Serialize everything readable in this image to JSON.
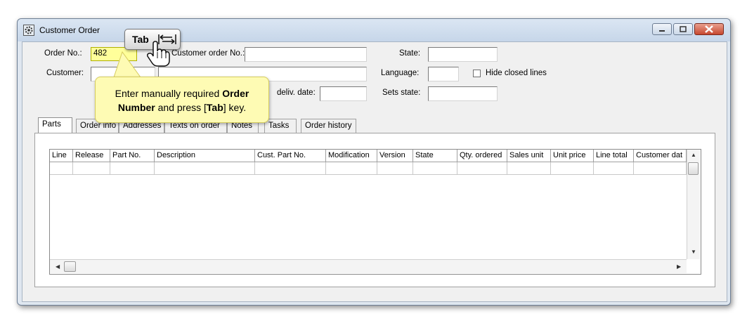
{
  "window": {
    "title": "Customer Order",
    "controls": [
      "minimize",
      "maximize",
      "close"
    ]
  },
  "form": {
    "order_no_label": "Order No.:",
    "order_no_value": "482",
    "customer_order_no_label": "Customer order No.:",
    "customer_order_no_value": "",
    "state_label": "State:",
    "state_value": "",
    "customer_label": "Customer:",
    "customer_value": "",
    "customer_name_value": "",
    "language_label": "Language:",
    "language_value": "",
    "hide_closed_lines_label": "Hide closed lines",
    "hide_closed_lines_checked": false,
    "deliv_date_label": "deliv. date:",
    "deliv_date_value": "",
    "sets_state_label": "Sets state:",
    "sets_state_value": ""
  },
  "tabs": [
    {
      "label": "Parts",
      "active": true
    },
    {
      "label": "Order info",
      "active": false
    },
    {
      "label": "Addresses",
      "active": false
    },
    {
      "label": "Texts on order",
      "active": false
    },
    {
      "label": "Notes",
      "active": false
    },
    {
      "label": "Tasks",
      "active": false
    },
    {
      "label": "Order history",
      "active": false
    }
  ],
  "grid": {
    "columns": [
      "Line",
      "Release",
      "Part No.",
      "Description",
      "Cust. Part No.",
      "Modification",
      "Version",
      "State",
      "Qty. ordered",
      "Sales unit",
      "Unit price",
      "Line total",
      "Customer dat"
    ],
    "rows": []
  },
  "tutorial": {
    "key_label": "Tab",
    "callout_part1": "Enter manually required ",
    "callout_bold1": "Order Number",
    "callout_part2": " and press [",
    "callout_bold2": "Tab",
    "callout_part3": "] key."
  },
  "colors": {
    "focus_field": "#ffff9a",
    "callout_bg": "#fefbb4",
    "close_button": "#c7472f"
  }
}
